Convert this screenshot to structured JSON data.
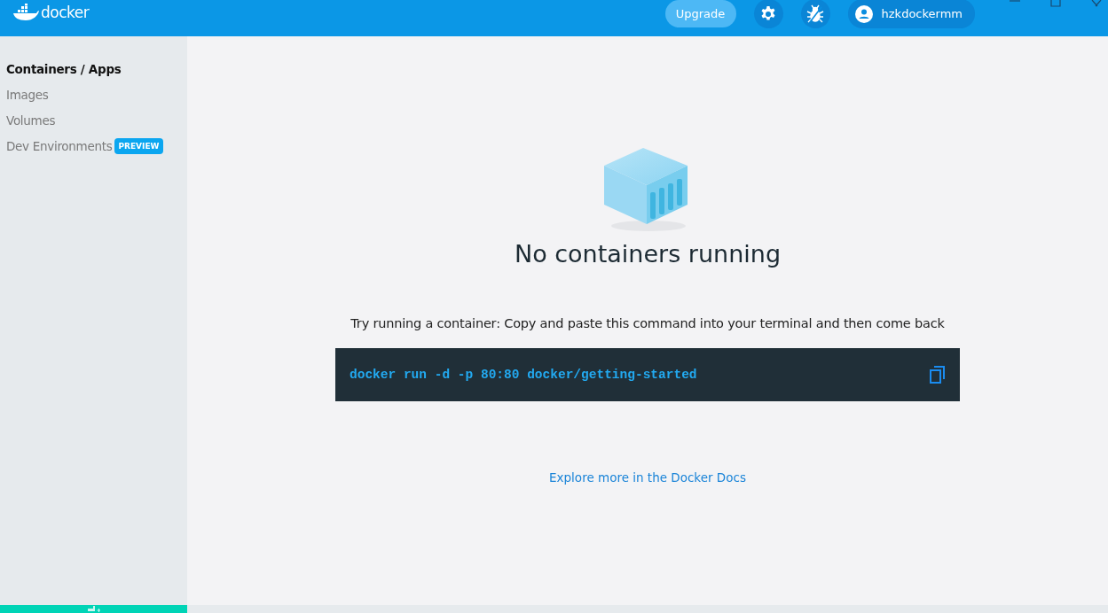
{
  "header": {
    "logo_text": "docker",
    "upgrade": "Upgrade",
    "user": "hzkdockermm"
  },
  "sidebar": {
    "items": [
      {
        "label": "Containers / Apps",
        "selected": true
      },
      {
        "label": "Images",
        "selected": false
      },
      {
        "label": "Volumes",
        "selected": false
      },
      {
        "label": "Dev Environments",
        "selected": false,
        "badge": "PREVIEW"
      }
    ]
  },
  "main": {
    "title": "No containers running",
    "hint": "Try running a container: Copy and paste this command into your terminal and then come back",
    "command": "docker run -d -p 80:80 docker/getting-started",
    "link": "Explore more in the Docker Docs"
  }
}
